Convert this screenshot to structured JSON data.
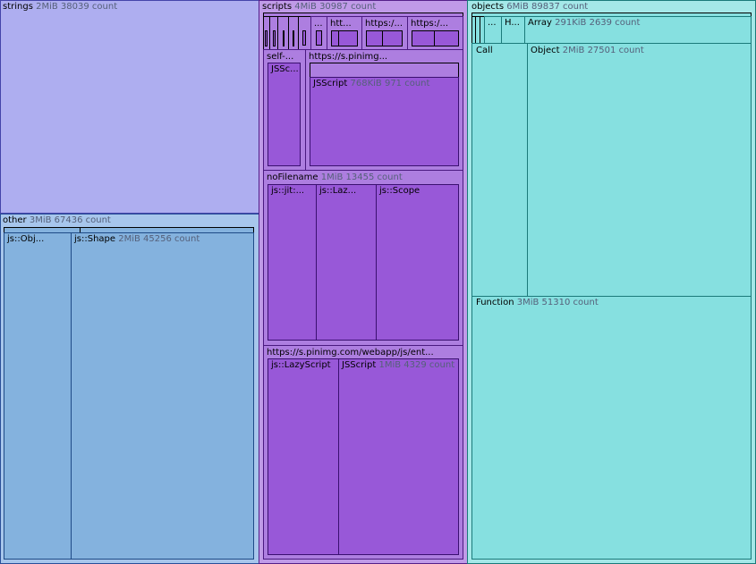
{
  "strings": {
    "name": "strings",
    "info": "2MiB 38039 count"
  },
  "other": {
    "name": "other",
    "info": "3MiB 67436 count",
    "obj": {
      "name": "js::Obj..."
    },
    "shape": {
      "name": "js::Shape",
      "info": "2MiB 45256 count"
    }
  },
  "scripts": {
    "name": "scripts",
    "info": "4MiB 30987 count",
    "ellipsis": "...",
    "htt": "htt...",
    "https1": "https:/...",
    "https2": "https:/...",
    "self": {
      "name": "self-...",
      "child": "JSSc..."
    },
    "pinimg": {
      "name": "https://s.pinimg...",
      "jsscript": "JSScript",
      "jsscript_info": "768KiB 971 count"
    },
    "nofile": {
      "name": "noFilename",
      "info": "1MiB 13455 count",
      "jit": "js::jit:...",
      "laz": "js::Laz...",
      "scope": "js::Scope"
    },
    "webapp": {
      "name": "https://s.pinimg.com/webapp/js/ent...",
      "lazy": "js::LazyScript",
      "jsscript": "JSScript",
      "jsscript_info": "1MiB 4329 count"
    }
  },
  "objects": {
    "name": "objects",
    "info": "6MiB 89837 count",
    "ellipsis": "...",
    "h": "H...",
    "array": {
      "name": "Array",
      "info": "291KiB 2639 count"
    },
    "call": "Call",
    "object": {
      "name": "Object",
      "info": "2MiB 27501 count"
    },
    "function": {
      "name": "Function",
      "info": "3MiB 51310 count"
    }
  }
}
